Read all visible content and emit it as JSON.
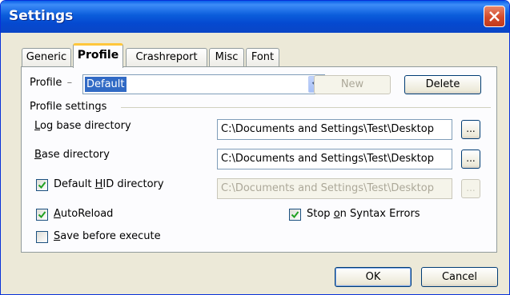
{
  "window": {
    "title": "Settings"
  },
  "tabs": [
    {
      "label": "Generic"
    },
    {
      "label": "Profile",
      "active": true
    },
    {
      "label": "Crashreport"
    },
    {
      "label": "Misc"
    },
    {
      "label": "Font"
    }
  ],
  "profile": {
    "label": "Profile",
    "dash": "–",
    "selected": "Default",
    "new_button": "New",
    "delete_button": "Delete"
  },
  "settings": {
    "group_title": "Profile settings",
    "log_base": {
      "label_prefix": "",
      "label_accel": "L",
      "label_rest": "og base directory",
      "value": "C:\\Documents and Settings\\Test\\Desktop",
      "browse": "..."
    },
    "base_dir": {
      "label_accel": "B",
      "label_rest": "ase directory",
      "value": "C:\\Documents and Settings\\Test\\Desktop",
      "browse": "..."
    },
    "default_hid": {
      "label_prefix": "Default ",
      "label_accel": "H",
      "label_rest": "ID directory",
      "checked": true,
      "value": "C:\\Documents and Settings\\Test\\Desktop",
      "browse": "..."
    },
    "autoreload": {
      "label_accel": "A",
      "label_rest": "utoReload",
      "checked": true
    },
    "stop_on_syntax": {
      "label_prefix": "Stop ",
      "label_accel": "o",
      "label_rest": "n Syntax Errors",
      "checked": true
    },
    "save_before": {
      "label_accel": "S",
      "label_rest": "ave before execute",
      "checked": false
    }
  },
  "footer": {
    "ok": "OK",
    "cancel": "Cancel"
  },
  "colors": {
    "titlebar": "#0a5fe8",
    "accent_tab": "#ffc73c",
    "close": "#d34a2a"
  }
}
